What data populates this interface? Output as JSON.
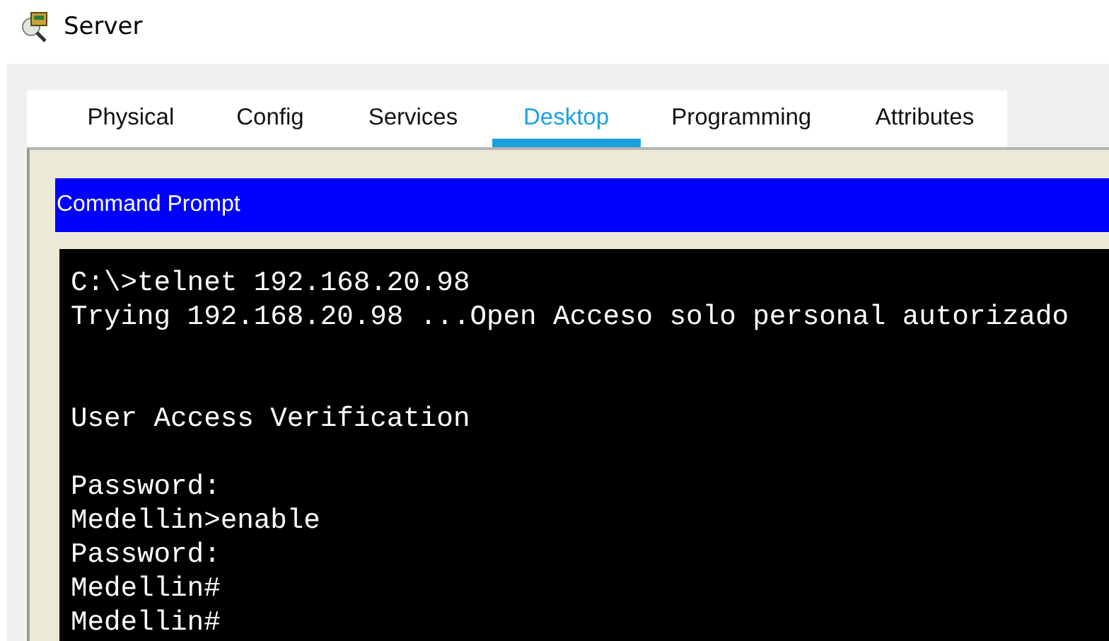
{
  "window": {
    "title": "Server"
  },
  "tabs": [
    {
      "label": "Physical",
      "selected": false
    },
    {
      "label": "Config",
      "selected": false
    },
    {
      "label": "Services",
      "selected": false
    },
    {
      "label": "Desktop",
      "selected": true
    },
    {
      "label": "Programming",
      "selected": false
    },
    {
      "label": "Attributes",
      "selected": false
    }
  ],
  "command_prompt": {
    "title": "Command Prompt",
    "lines": [
      {
        "kind": "text",
        "text": "C:\\>telnet 192.168.20.98"
      },
      {
        "kind": "text",
        "text": "Trying 192.168.20.98 ...Open Acceso solo personal autorizado"
      },
      {
        "kind": "blank"
      },
      {
        "kind": "blank"
      },
      {
        "kind": "text",
        "text": "User Access Verification"
      },
      {
        "kind": "blank"
      },
      {
        "kind": "text",
        "text": "Password:"
      },
      {
        "kind": "text",
        "text": "Medellin>enable"
      },
      {
        "kind": "text",
        "text": "Password:"
      },
      {
        "kind": "text",
        "text": "Medellin#"
      },
      {
        "kind": "text",
        "text": "Medellin#"
      }
    ]
  }
}
